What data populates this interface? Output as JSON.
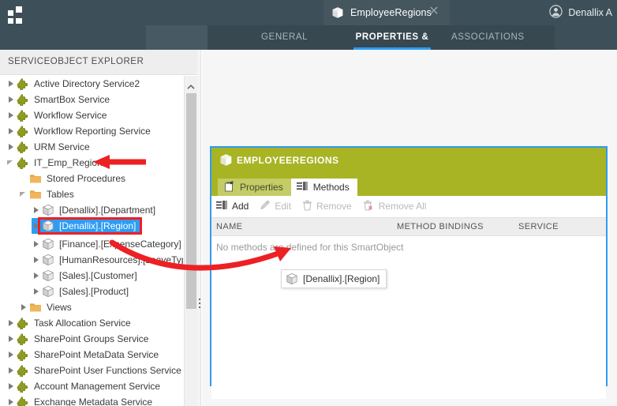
{
  "topbar": {
    "logo_icon": "grid-squares-logo",
    "document_tab": {
      "icon": "smartobject-cube-icon",
      "label": "EmployeeRegions",
      "close_icon": "close-icon",
      "close_glyph": "✕"
    },
    "user": {
      "avatar_icon": "user-avatar-icon",
      "name": "Denallix A"
    }
  },
  "subtabs": [
    {
      "label": "GENERAL",
      "active": false
    },
    {
      "label": "PROPERTIES & METHODS",
      "active": true
    },
    {
      "label": "ASSOCIATIONS",
      "active": false
    }
  ],
  "sidebar": {
    "header": "SERVICEOBJECT EXPLORER",
    "scrollbar": {
      "up_arrow_icon": "chevron-up-icon"
    },
    "tree": [
      {
        "label": "Active Directory Service2",
        "icon": "service-puzzle-icon",
        "indent": 0,
        "twist": "collapsed"
      },
      {
        "label": "SmartBox Service",
        "icon": "service-puzzle-icon",
        "indent": 0,
        "twist": "collapsed"
      },
      {
        "label": "Workflow Service",
        "icon": "service-puzzle-icon",
        "indent": 0,
        "twist": "collapsed"
      },
      {
        "label": "Workflow Reporting Service",
        "icon": "service-puzzle-icon",
        "indent": 0,
        "twist": "collapsed"
      },
      {
        "label": "URM Service",
        "icon": "service-puzzle-icon",
        "indent": 0,
        "twist": "collapsed"
      },
      {
        "label": "IT_Emp_Regions",
        "icon": "service-puzzle-icon",
        "indent": 0,
        "twist": "expanded"
      },
      {
        "label": "Stored Procedures",
        "icon": "folder-icon",
        "indent": 1,
        "twist": "empty"
      },
      {
        "label": "Tables",
        "icon": "folder-icon",
        "indent": 1,
        "twist": "expanded"
      },
      {
        "label": "[Denallix].[Department]",
        "icon": "serviceobject-cube-icon",
        "indent": 2,
        "twist": "collapsed"
      },
      {
        "label": "[Denallix].[Region]",
        "icon": "serviceobject-cube-icon",
        "indent": 2,
        "twist": "collapsed",
        "selected": true
      },
      {
        "label": "[Finance].[ExpenseCategory]",
        "icon": "serviceobject-cube-icon",
        "indent": 2,
        "twist": "collapsed"
      },
      {
        "label": "[HumanResources].[LeaveType]",
        "icon": "serviceobject-cube-icon",
        "indent": 2,
        "twist": "collapsed"
      },
      {
        "label": "[Sales].[Customer]",
        "icon": "serviceobject-cube-icon",
        "indent": 2,
        "twist": "collapsed"
      },
      {
        "label": "[Sales].[Product]",
        "icon": "serviceobject-cube-icon",
        "indent": 2,
        "twist": "collapsed"
      },
      {
        "label": "Views",
        "icon": "folder-icon",
        "indent": 1,
        "twist": "collapsed"
      },
      {
        "label": "Task Allocation Service",
        "icon": "service-puzzle-icon",
        "indent": 0,
        "twist": "collapsed"
      },
      {
        "label": "SharePoint Groups Service",
        "icon": "service-puzzle-icon",
        "indent": 0,
        "twist": "collapsed"
      },
      {
        "label": "SharePoint MetaData Service",
        "icon": "service-puzzle-icon",
        "indent": 0,
        "twist": "collapsed"
      },
      {
        "label": "SharePoint User Functions Service",
        "icon": "service-puzzle-icon",
        "indent": 0,
        "twist": "collapsed"
      },
      {
        "label": "Account Management Service",
        "icon": "service-puzzle-icon",
        "indent": 0,
        "twist": "collapsed"
      },
      {
        "label": "Exchange Metadata Service",
        "icon": "service-puzzle-icon",
        "indent": 0,
        "twist": "collapsed"
      }
    ]
  },
  "card": {
    "title": "EMPLOYEEREGIONS",
    "title_icon": "smartobject-cube-icon",
    "tabs": [
      {
        "label": "Properties",
        "icon": "properties-icon",
        "active": false
      },
      {
        "label": "Methods",
        "icon": "methods-icon",
        "active": true
      }
    ],
    "toolbar": [
      {
        "label": "Add",
        "icon": "add-method-icon",
        "disabled": false
      },
      {
        "label": "Edit",
        "icon": "pencil-edit-icon",
        "disabled": true
      },
      {
        "label": "Remove",
        "icon": "trash-remove-icon",
        "disabled": true
      },
      {
        "label": "Remove All",
        "icon": "trash-remove-all-icon",
        "disabled": true
      }
    ],
    "columns": [
      "NAME",
      "METHOD BINDINGS",
      "SERVICE"
    ],
    "empty_message": "No methods are defined for this SmartObject",
    "drag_chip": {
      "label": "[Denallix].[Region]",
      "icon": "serviceobject-cube-icon"
    }
  },
  "annotations": {
    "arrow_to_service": "red-arrow-pointing-to-it-emp-regions",
    "arrow_drag": "red-curved-arrow-drag-to-methods",
    "highlight_box": "red-highlight-box-denallix-region"
  },
  "colors": {
    "topbar": "#3d4f58",
    "accent_blue": "#2e9cf2",
    "card_header_olive": "#a8b423",
    "annotation_red": "#ed2024",
    "selection_blue": "#2e9cf2"
  }
}
